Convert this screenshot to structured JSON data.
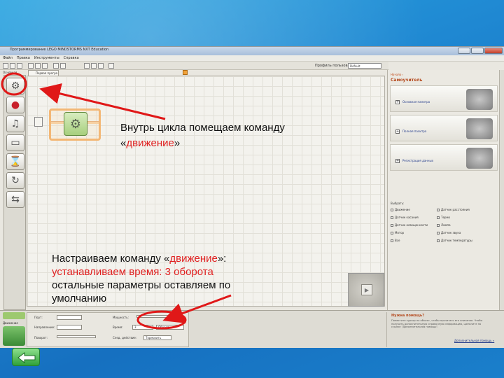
{
  "window": {
    "title": "Программирование LEGO MINDSTORMS NXT Education"
  },
  "menu": [
    "Файл",
    "Правка",
    "Инструменты",
    "Справка"
  ],
  "toolbar": {
    "profile_label": "Профиль пользователя:",
    "profile_value": "Default"
  },
  "palette": {
    "tab_label": "Основная",
    "blocks": [
      "move-icon",
      "record-icon",
      "sound-icon",
      "display-icon",
      "wait-icon",
      "loop-icon",
      "switch-icon"
    ]
  },
  "canvas": {
    "tab_label": "Первая програ"
  },
  "right_panel": {
    "header": "Начало ›",
    "title": "Самоучитель",
    "cards": [
      "Основная палитра",
      "Полная палитра",
      "Регистрация данных"
    ],
    "select_label": "Выбрать:",
    "options_left": [
      "Движение",
      "Датчик касания",
      "Датчик освещенности",
      "Мотор",
      "Все"
    ],
    "options_right": [
      "Датчик расстояния",
      "Термо",
      "Лампа",
      "Датчик звука",
      "Датчик температуры"
    ]
  },
  "bottom": {
    "block_label": "Движение",
    "rows": [
      "Порт:",
      "Направление:",
      "Поворот:",
      "Мощность:",
      "Время:",
      "След. действие:"
    ],
    "duration_value": "3",
    "duration_unit": "Обороты",
    "next_action": "Тормозить"
  },
  "help": {
    "title": "Нужна помощь?",
    "body": "Поместите курсор на объект, чтобы прочитать его описание. Чтобы получить дополнительную справочную информацию, щелкните по ссылке \"Дополнительная помощь\".",
    "link": "Дополнительная помощь »"
  },
  "annotations": {
    "loop_text_1": "Внутрь цикла помещаем команду",
    "loop_text_2_open": "«",
    "loop_text_2_red": "движение",
    "loop_text_2_close": "»",
    "setup_text_1_black": "Настраиваем команду «",
    "setup_text_1_red": "движение",
    "setup_text_1_close": "»:",
    "setup_text_2": "устанавливаем время: 3 оборота",
    "setup_text_3": "остальные параметры оставляем по",
    "setup_text_4": "умолчанию"
  }
}
